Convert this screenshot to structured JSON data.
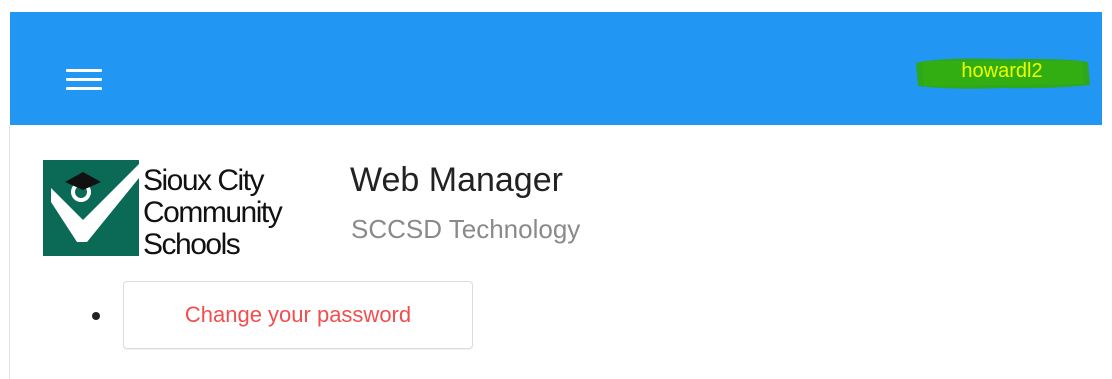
{
  "header": {
    "menu_icon": "hamburger-menu-icon",
    "username": "howardl2",
    "bar_color": "#2196f3",
    "username_highlight_color": "#2fa80a"
  },
  "branding": {
    "logo_lines": [
      "Sioux City",
      "Community",
      "Schools"
    ],
    "logo_color": "#0a6a55",
    "app_title": "Web Manager",
    "app_subtitle": "SCCSD Technology"
  },
  "actions": {
    "items": [
      {
        "label": "Change your password",
        "color": "#f24e4e"
      }
    ]
  }
}
